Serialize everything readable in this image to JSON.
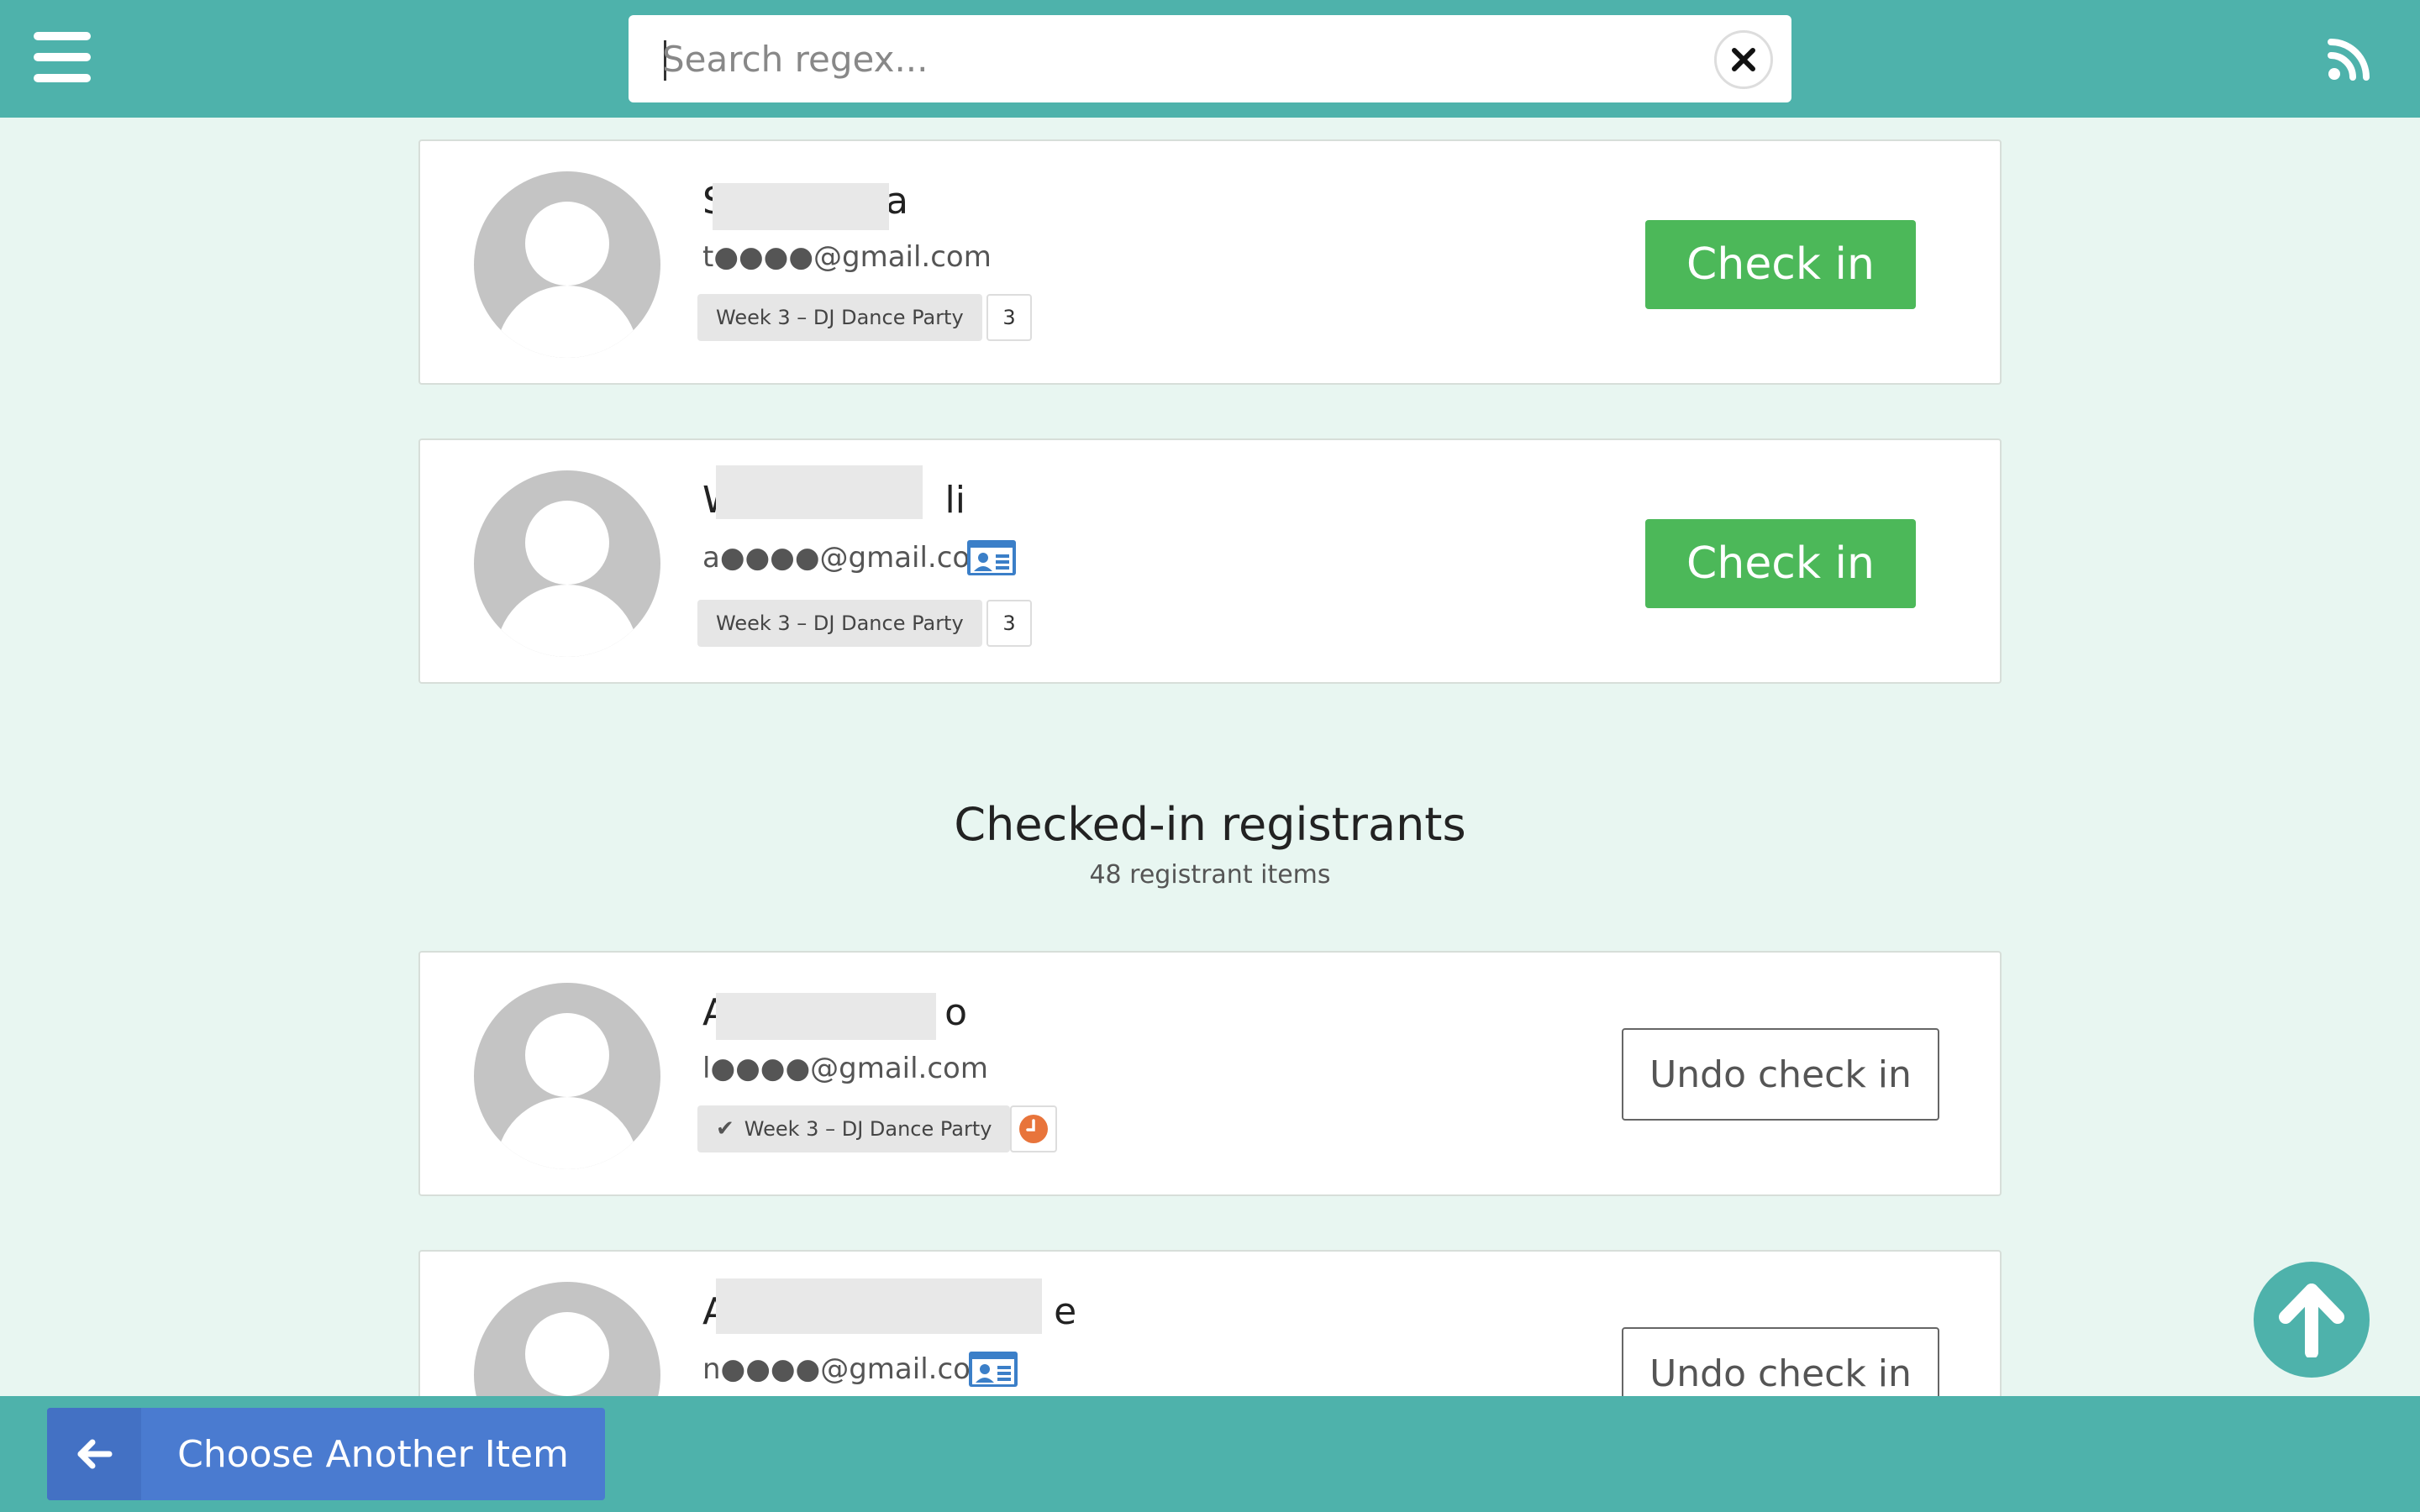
{
  "header": {
    "search_placeholder": "Search regex..."
  },
  "pending": [
    {
      "name_first": "S",
      "name_last": "a",
      "email": "t●●●●@gmail.com",
      "item": "Week 3 – DJ Dance Party",
      "count": "3",
      "button": "Check in"
    },
    {
      "name_first": "W",
      "name_last": "li",
      "email": "a●●●●@gmail.com",
      "item": "Week 3 – DJ Dance Party",
      "count": "3",
      "button": "Check in"
    }
  ],
  "checked_in_section": {
    "title": "Checked-in registrants",
    "subtitle": "48 registrant items"
  },
  "checked_in": [
    {
      "name_first": "A",
      "name_last": "o",
      "email": "l●●●●@gmail.com",
      "item": "Week 3 – DJ Dance Party",
      "button": "Undo check in"
    },
    {
      "name_first": "A",
      "name_last": "e",
      "email": "n●●●●@gmail.com",
      "button": "Undo check in"
    }
  ],
  "footer": {
    "choose_label": "Choose Another Item"
  },
  "icons": {
    "menu": "menu-icon",
    "clear": "close-icon",
    "rss": "rss-icon",
    "id_card": "id-card-icon",
    "clock": "clock-icon",
    "back": "arrow-left-icon",
    "scroll_top": "arrow-up-icon"
  },
  "colors": {
    "bar": "#4eb2ab",
    "background": "#e8f6f1",
    "checkin": "#4cb859",
    "choose": "#4a7bd0",
    "id_card": "#3b7fc8",
    "clock": "#e8743b"
  }
}
